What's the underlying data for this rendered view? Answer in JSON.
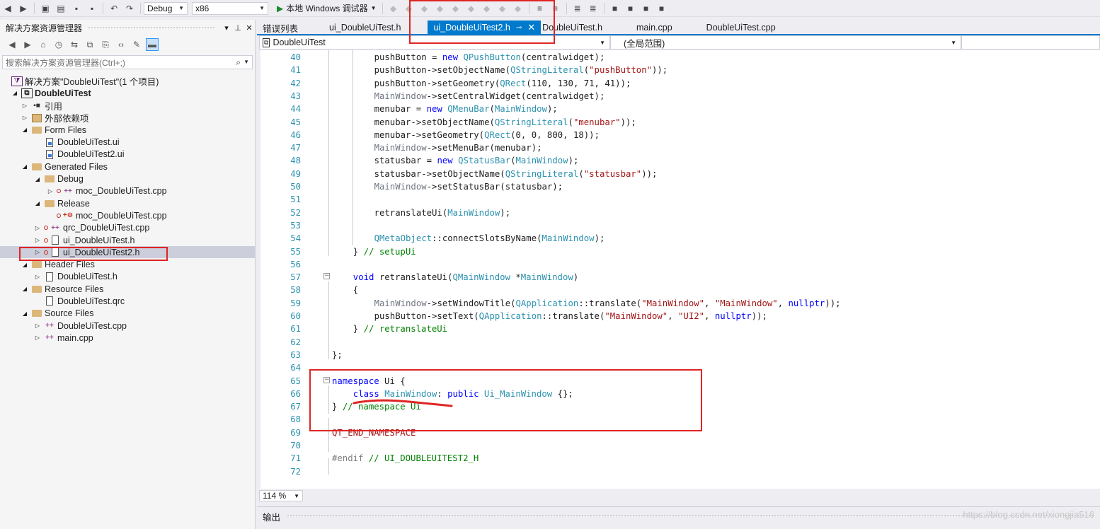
{
  "toolbar": {
    "config": "Debug",
    "platform": "x86",
    "run_label": "本地 Windows 调试器"
  },
  "solution_explorer": {
    "title": "解决方案资源管理器",
    "search_placeholder": "搜索解决方案资源管理器(Ctrl+;)",
    "tree": [
      {
        "label": "解决方案\"DoubleUiTest\"(1 个项目)",
        "icon": "solution-icon"
      },
      {
        "label": "DoubleUiTest",
        "icon": "project-icon"
      },
      {
        "label": "引用",
        "icon": "references-icon"
      },
      {
        "label": "外部依赖项",
        "icon": "external-deps-icon"
      },
      {
        "label": "Form Files",
        "icon": "folder-icon"
      },
      {
        "label": "DoubleUiTest.ui",
        "icon": "ui-file-icon"
      },
      {
        "label": "DoubleUiTest2.ui",
        "icon": "ui-file-icon"
      },
      {
        "label": "Generated Files",
        "icon": "folder-icon"
      },
      {
        "label": "Debug",
        "icon": "folder-icon"
      },
      {
        "label": "moc_DoubleUiTest.cpp",
        "icon": "cpp-file-icon"
      },
      {
        "label": "Release",
        "icon": "folder-icon"
      },
      {
        "label": "moc_DoubleUiTest.cpp",
        "icon": "cpp-file-excluded-icon"
      },
      {
        "label": "qrc_DoubleUiTest.cpp",
        "icon": "cpp-file-icon"
      },
      {
        "label": "ui_DoubleUiTest.h",
        "icon": "header-file-icon"
      },
      {
        "label": "ui_DoubleUiTest2.h",
        "icon": "header-file-icon"
      },
      {
        "label": "Header Files",
        "icon": "folder-icon"
      },
      {
        "label": "DoubleUiTest.h",
        "icon": "header-file-icon"
      },
      {
        "label": "Resource Files",
        "icon": "folder-icon"
      },
      {
        "label": "DoubleUiTest.qrc",
        "icon": "file-icon"
      },
      {
        "label": "Source Files",
        "icon": "folder-icon"
      },
      {
        "label": "DoubleUiTest.cpp",
        "icon": "cpp-file-icon"
      },
      {
        "label": "main.cpp",
        "icon": "cpp-file-icon"
      }
    ]
  },
  "tabs": [
    {
      "label": "错误列表"
    },
    {
      "label": "ui_DoubleUiTest.h"
    },
    {
      "label": "ui_DoubleUiTest2.h",
      "active": true
    },
    {
      "label": "DoubleUiTest.h"
    },
    {
      "label": "main.cpp"
    },
    {
      "label": "DoubleUiTest.cpp"
    }
  ],
  "navbar": {
    "project": "DoubleUiTest",
    "scope": "(全局范围)"
  },
  "editor": {
    "zoom": "114 %",
    "lines": [
      {
        "n": "40",
        "code": "pushButton = new QPushButton(centralwidget);"
      },
      {
        "n": "41",
        "code": "pushButton->setObjectName(QStringLiteral(\"pushButton\"));"
      },
      {
        "n": "42",
        "code": "pushButton->setGeometry(QRect(110, 130, 71, 41));"
      },
      {
        "n": "43",
        "code": "MainWindow->setCentralWidget(centralwidget);"
      },
      {
        "n": "44",
        "code": "menubar = new QMenuBar(MainWindow);"
      },
      {
        "n": "45",
        "code": "menubar->setObjectName(QStringLiteral(\"menubar\"));"
      },
      {
        "n": "46",
        "code": "menubar->setGeometry(QRect(0, 0, 800, 18));"
      },
      {
        "n": "47",
        "code": "MainWindow->setMenuBar(menubar);"
      },
      {
        "n": "48",
        "code": "statusbar = new QStatusBar(MainWindow);"
      },
      {
        "n": "49",
        "code": "statusbar->setObjectName(QStringLiteral(\"statusbar\"));"
      },
      {
        "n": "50",
        "code": "MainWindow->setStatusBar(statusbar);"
      },
      {
        "n": "51",
        "code": ""
      },
      {
        "n": "52",
        "code": "retranslateUi(MainWindow);"
      },
      {
        "n": "53",
        "code": ""
      },
      {
        "n": "54",
        "code": "QMetaObject::connectSlotsByName(MainWindow);"
      },
      {
        "n": "55",
        "code": "} // setupUi"
      },
      {
        "n": "56",
        "code": ""
      },
      {
        "n": "57",
        "code": "void retranslateUi(QMainWindow *MainWindow)"
      },
      {
        "n": "58",
        "code": "{"
      },
      {
        "n": "59",
        "code": "MainWindow->setWindowTitle(QApplication::translate(\"MainWindow\", \"MainWindow\", nullptr));"
      },
      {
        "n": "60",
        "code": "pushButton->setText(QApplication::translate(\"MainWindow\", \"UI2\", nullptr));"
      },
      {
        "n": "61",
        "code": "} // retranslateUi"
      },
      {
        "n": "62",
        "code": ""
      },
      {
        "n": "63",
        "code": "};"
      },
      {
        "n": "64",
        "code": ""
      },
      {
        "n": "65",
        "code": "namespace Ui {"
      },
      {
        "n": "66",
        "code": "class MainWindow: public Ui_MainWindow {};"
      },
      {
        "n": "67",
        "code": "} // namespace Ui"
      },
      {
        "n": "68",
        "code": ""
      },
      {
        "n": "69",
        "code": "QT_END_NAMESPACE"
      },
      {
        "n": "70",
        "code": ""
      },
      {
        "n": "71",
        "code": "#endif // UI_DOUBLEUITEST2_H"
      },
      {
        "n": "72",
        "code": ""
      }
    ]
  },
  "output": {
    "title": "输出"
  },
  "watermark": "https://blog.csdn.net/xiongjia516"
}
